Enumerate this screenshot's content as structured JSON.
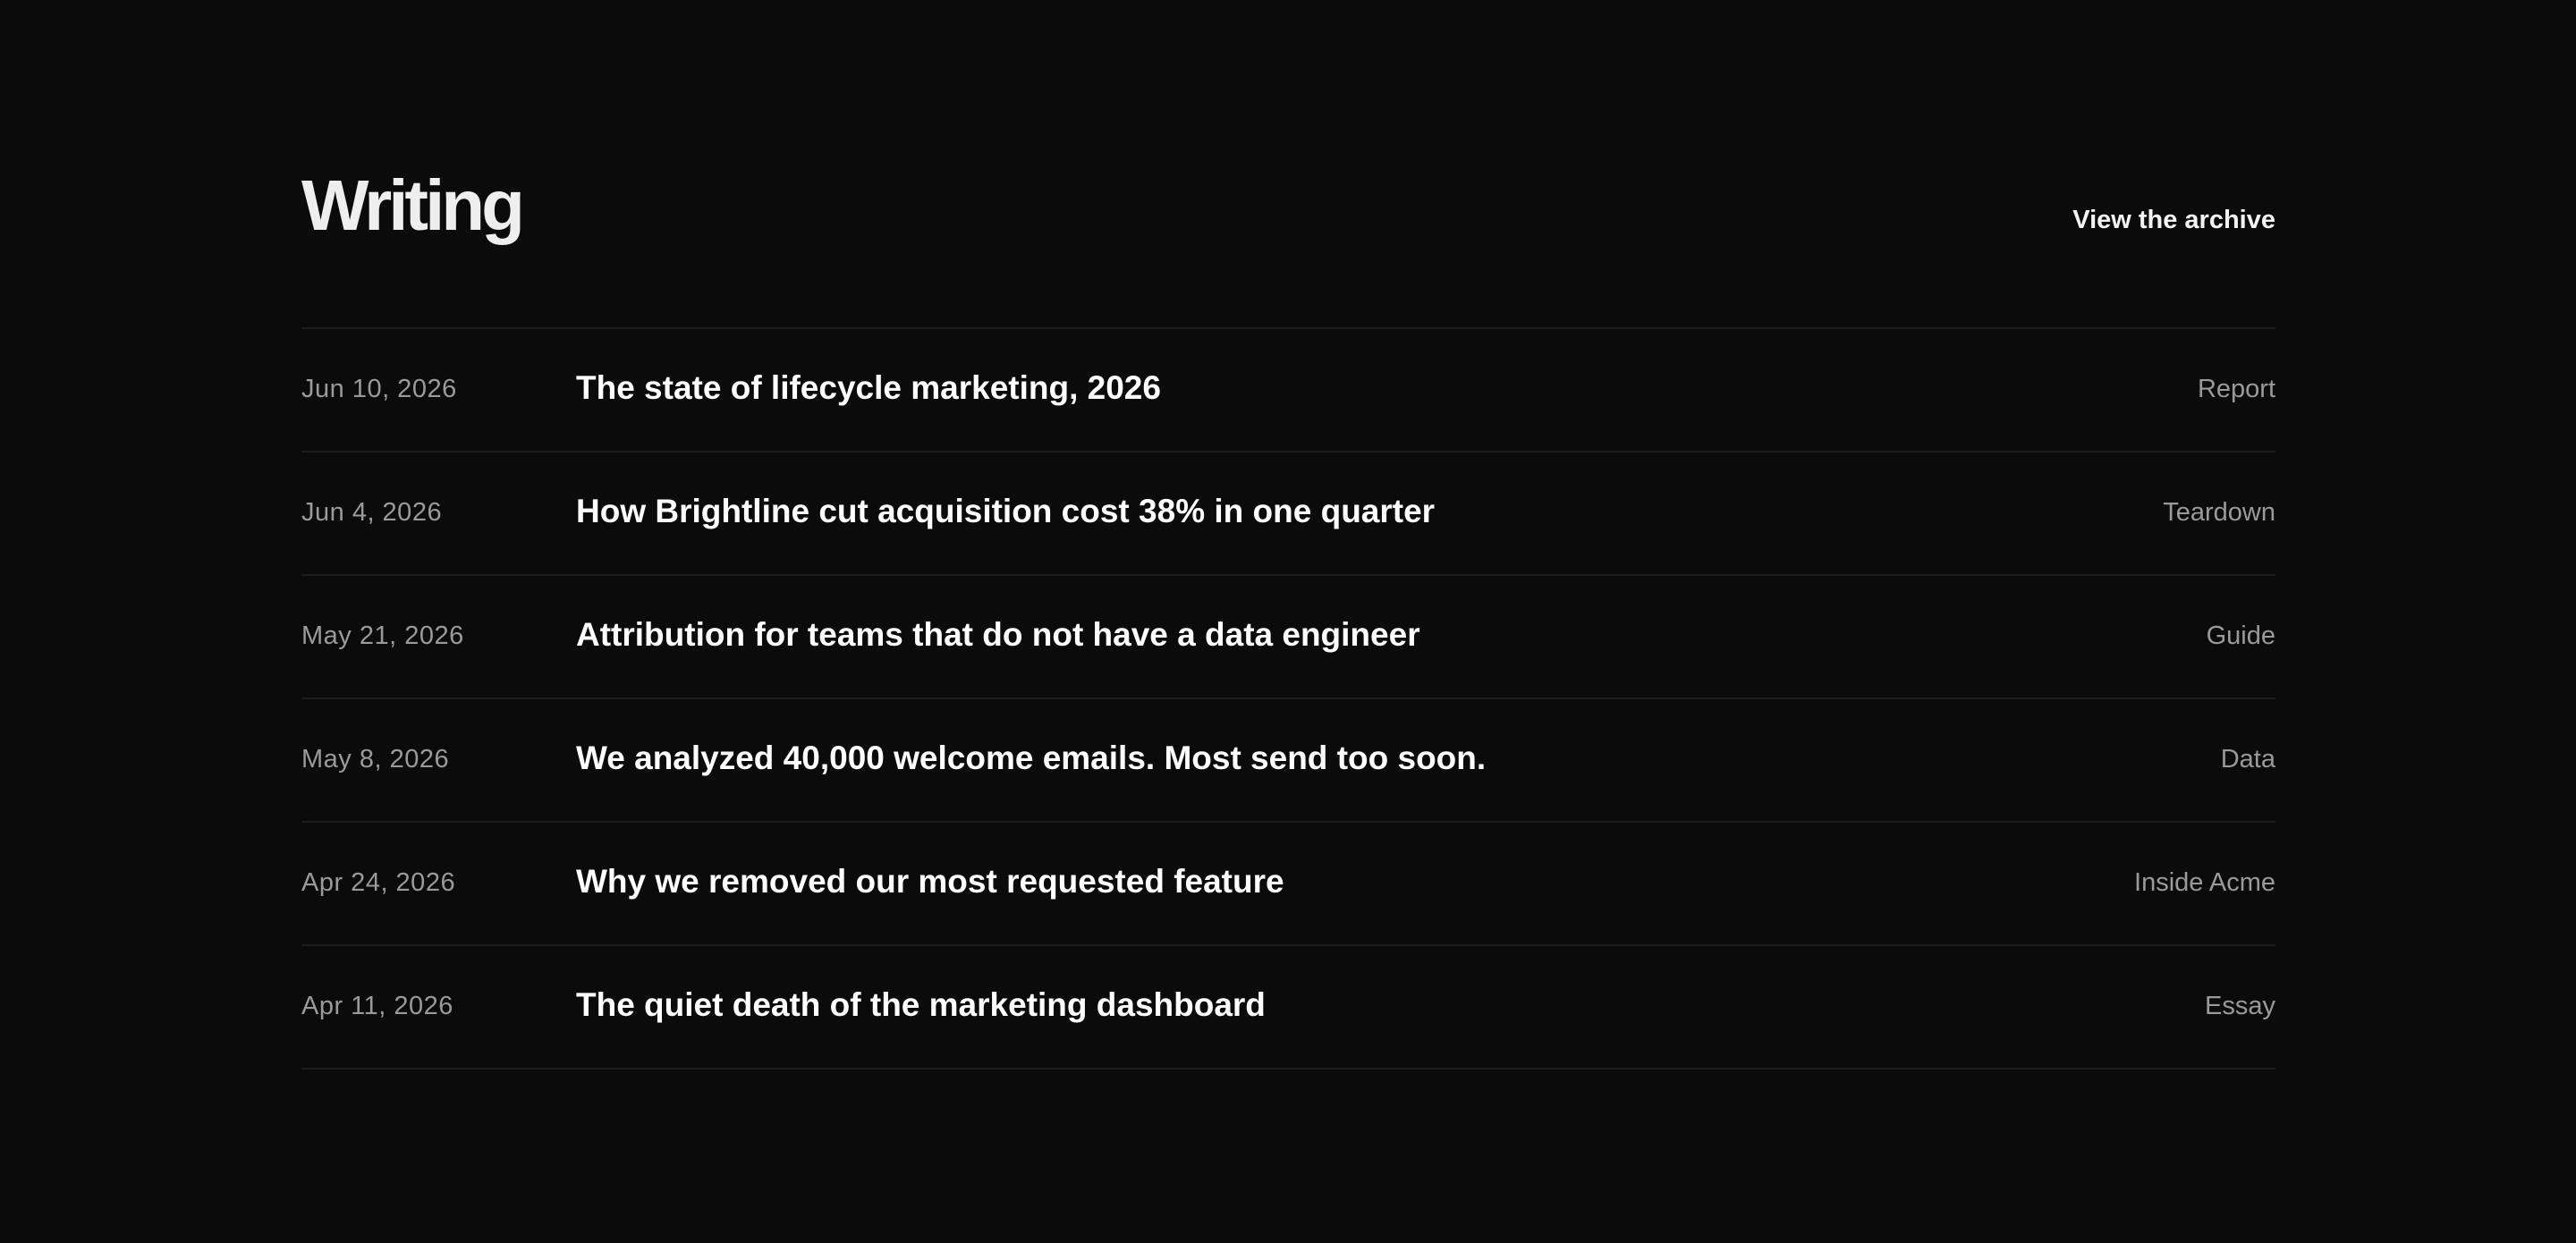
{
  "section": {
    "title": "Writing",
    "archive_link": "View the archive"
  },
  "posts": [
    {
      "date": "Jun 10, 2026",
      "title": "The state of lifecycle marketing, 2026",
      "category": "Report"
    },
    {
      "date": "Jun 4, 2026",
      "title": "How Brightline cut acquisition cost 38% in one quarter",
      "category": "Teardown"
    },
    {
      "date": "May 21, 2026",
      "title": "Attribution for teams that do not have a data engineer",
      "category": "Guide"
    },
    {
      "date": "May 8, 2026",
      "title": "We analyzed 40,000 welcome emails. Most send too soon.",
      "category": "Data"
    },
    {
      "date": "Apr 24, 2026",
      "title": "Why we removed our most requested feature",
      "category": "Inside Acme"
    },
    {
      "date": "Apr 11, 2026",
      "title": "The quiet death of the marketing dashboard",
      "category": "Essay"
    }
  ],
  "colors": {
    "background": "#0b0b0b",
    "title": "#eeeeee",
    "post_title": "#ffffff",
    "muted_text": "#9a9a9a",
    "divider": "#1c1c1c"
  }
}
